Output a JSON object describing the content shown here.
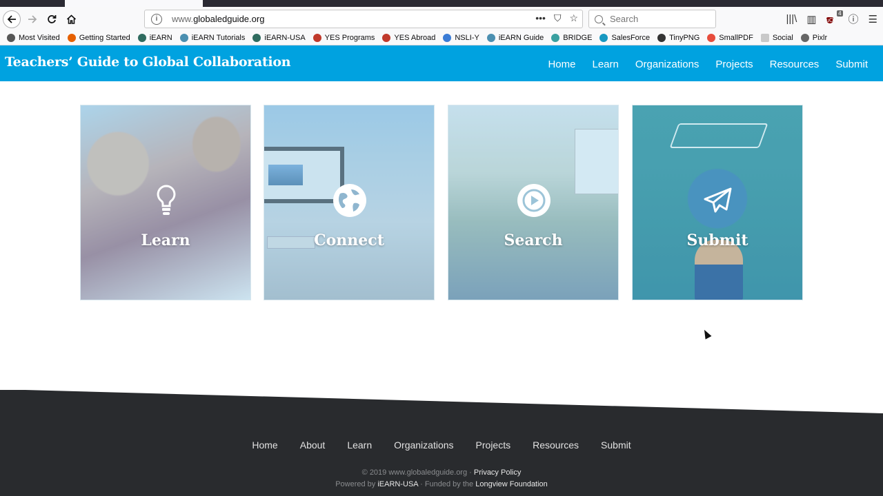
{
  "browser": {
    "url_prefix": "www.",
    "url_domain": "globaledguide.org",
    "search_placeholder": "Search",
    "extension_badge": "4",
    "bookmarks": [
      {
        "label": "Most Visited",
        "color": "#555555"
      },
      {
        "label": "Getting Started",
        "color": "#e66000"
      },
      {
        "label": "iEARN",
        "color": "#2f6b5f"
      },
      {
        "label": "iEARN Tutorials",
        "color": "#4b8fb0"
      },
      {
        "label": "iEARN-USA",
        "color": "#2f6b5f"
      },
      {
        "label": "YES Programs",
        "color": "#c0392b"
      },
      {
        "label": "YES Abroad",
        "color": "#c0392b"
      },
      {
        "label": "NSLI-Y",
        "color": "#3a7bd5"
      },
      {
        "label": "iEARN Guide",
        "color": "#4b8fb0"
      },
      {
        "label": "BRIDGE",
        "color": "#3aa0a0"
      },
      {
        "label": "SalesForce",
        "color": "#1798c1"
      },
      {
        "label": "TinyPNG",
        "color": "#333333"
      },
      {
        "label": "SmallPDF",
        "color": "#e74c3c"
      },
      {
        "label": "Social",
        "color": "#888888"
      },
      {
        "label": "Pixlr",
        "color": "#666666"
      }
    ]
  },
  "site": {
    "title": "Teachers’ Guide to Global Collaboration",
    "brand_color": "#00a2e0",
    "nav": [
      "Home",
      "Learn",
      "Organizations",
      "Projects",
      "Resources",
      "Submit"
    ]
  },
  "tiles": [
    {
      "label": "Learn",
      "icon": "lightbulb-icon"
    },
    {
      "label": "Connect",
      "icon": "globe-icon"
    },
    {
      "label": "Search",
      "icon": "play-icon"
    },
    {
      "label": "Submit",
      "icon": "paper-plane-icon"
    }
  ],
  "footer": {
    "nav": [
      "Home",
      "About",
      "Learn",
      "Organizations",
      "Projects",
      "Resources",
      "Submit"
    ],
    "copyright_prefix": "© 2019 www.globaledguide.org ·",
    "privacy_label": "Privacy Policy",
    "powered_prefix": "Powered by",
    "powered_org": "iEARN-USA",
    "funded_prefix": "· Funded by the",
    "funder": "Longview Foundation",
    "background": "#292b2e"
  }
}
